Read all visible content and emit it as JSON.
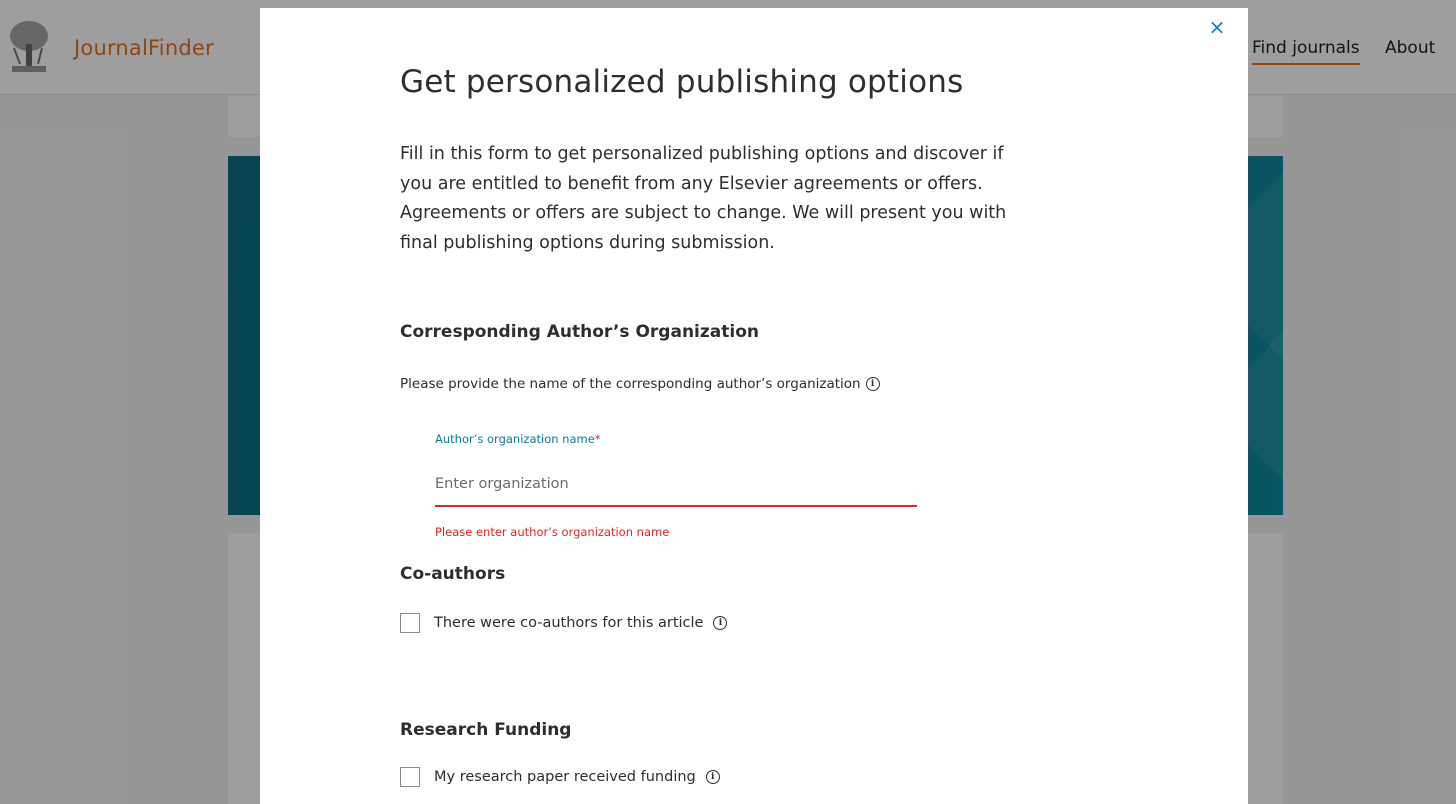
{
  "header": {
    "brand": "JournalFinder",
    "nav": {
      "find_journals": "Find journals",
      "about": "About"
    }
  },
  "modal": {
    "close_symbol": "×",
    "title": "Get personalized publishing options",
    "intro": "Fill in this form to get personalized publishing options and discover if you are entitled to benefit from any Elsevier agreements or offers. Agreements or offers are subject to change. We will present you with final publishing options during submission.",
    "organization": {
      "heading": "Corresponding Author’s Organization",
      "help_text": "Please provide the name of the corresponding author’s organization",
      "field_label": "Author’s organization name",
      "required_mark": "*",
      "placeholder": "Enter organization",
      "value": "",
      "error": "Please enter author’s organization name"
    },
    "coauthors": {
      "heading": "Co-authors",
      "checkbox_label": "There were co-authors for this article",
      "checked": false
    },
    "funding": {
      "heading": "Research Funding",
      "checkbox_label": "My research paper received funding",
      "checked": false
    }
  },
  "icons": {
    "logo": "elsevier-tree-logo",
    "info": "info-icon",
    "close": "close-icon"
  },
  "colors": {
    "brand": "#e9711c",
    "accent": "#0a7d9b",
    "error": "#d8282b",
    "hero": "#0b7d93"
  }
}
